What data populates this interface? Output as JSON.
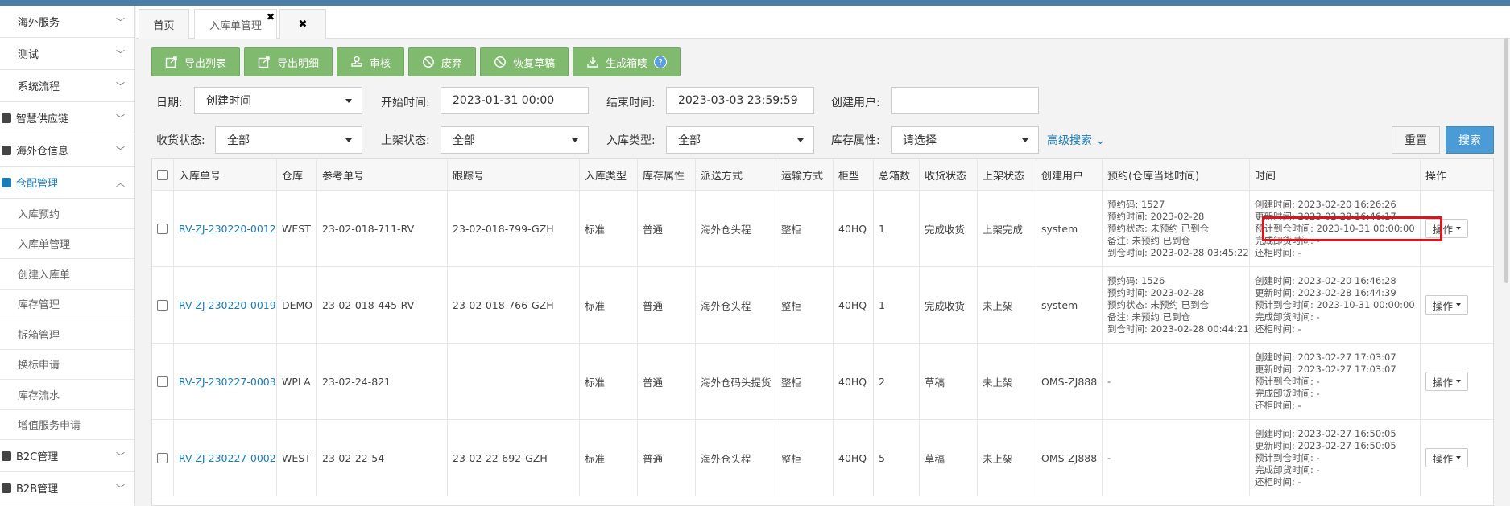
{
  "sidebar": {
    "groups_top": [
      {
        "label": "海外服务"
      },
      {
        "label": "测试"
      },
      {
        "label": "系统流程"
      },
      {
        "label": "智慧供应链"
      },
      {
        "label": "海外仓信息"
      },
      {
        "label": "仓配管理"
      }
    ],
    "sub_items": [
      {
        "label": "入库预约"
      },
      {
        "label": "入库单管理"
      },
      {
        "label": "创建入库单"
      },
      {
        "label": "库存管理"
      },
      {
        "label": "拆箱管理"
      },
      {
        "label": "换标申请"
      },
      {
        "label": "库存流水"
      },
      {
        "label": "增值服务申请"
      }
    ],
    "groups_bottom": [
      {
        "label": "B2C管理"
      },
      {
        "label": "B2B管理"
      }
    ]
  },
  "tabs": [
    {
      "label": "首页"
    },
    {
      "label": "入库单管理"
    }
  ],
  "toolbar": {
    "buttons": [
      {
        "label": "导出列表",
        "icon": "export-icon"
      },
      {
        "label": "导出明细",
        "icon": "export-icon"
      },
      {
        "label": "审核",
        "icon": "stamp-icon"
      },
      {
        "label": "废弃",
        "icon": "ban-icon"
      },
      {
        "label": "恢复草稿",
        "icon": "ban-icon"
      },
      {
        "label": "生成箱唛",
        "icon": "download-icon"
      }
    ],
    "help": "?"
  },
  "filters": {
    "date_label": "日期:",
    "date_value": "创建时间",
    "start_label": "开始时间:",
    "start_value": "2023-01-31 00:00",
    "end_label": "结束时间:",
    "end_value": "2023-03-03 23:59:59",
    "user_label": "创建用户:",
    "user_value": "",
    "receive_label": "收货状态:",
    "receive_value": "全部",
    "shelf_label": "上架状态:",
    "shelf_value": "全部",
    "type_label": "入库类型:",
    "type_value": "全部",
    "attr_label": "库存属性:",
    "attr_value": "请选择",
    "advanced": "高级搜索 ⌄",
    "reset": "重置",
    "search": "搜索"
  },
  "table": {
    "headers": [
      "入库单号",
      "仓库",
      "参考单号",
      "跟踪号",
      "入库类型",
      "库存属性",
      "派送方式",
      "运输方式",
      "柜型",
      "总箱数",
      "收货状态",
      "上架状态",
      "创建用户",
      "预约(仓库当地时间)",
      "时间",
      "操作"
    ],
    "rows": [
      {
        "order": "RV-ZJ-230220-0012",
        "warehouse": "WEST",
        "ref": "23-02-018-711-RV",
        "track": "23-02-018-799-GZH",
        "type": "标准",
        "attr": "普通",
        "delivery": "海外仓头程",
        "transport": "整柜",
        "container": "40HQ",
        "boxes": "1",
        "receive": "完成收货",
        "shelf": "上架完成",
        "user": "system",
        "booking": [
          "预约码: 1527",
          "预约时间: 2023-02-28",
          "预约状态: 未预约 已到仓",
          "备注: 未预约 已到仓",
          "到仓时间: 2023-02-28 03:45:22"
        ],
        "time": [
          "创建时间: 2023-02-20 16:26:26",
          "更新时间: 2023-02-28 16:46:17",
          "预计到仓时间: 2023-10-31 00:00:00",
          "完成卸货时间: -",
          "还柜时间: -"
        ],
        "op": "操作"
      },
      {
        "order": "RV-ZJ-230220-0019",
        "warehouse": "DEMO",
        "ref": "23-02-018-445-RV",
        "track": "23-02-018-766-GZH",
        "type": "标准",
        "attr": "普通",
        "delivery": "海外仓头程",
        "transport": "整柜",
        "container": "40HQ",
        "boxes": "1",
        "receive": "完成收货",
        "shelf": "未上架",
        "user": "system",
        "booking": [
          "预约码: 1526",
          "预约时间: 2023-02-28",
          "预约状态: 未预约 已到仓",
          "备注: 未预约 已到仓",
          "到仓时间: 2023-02-28 00:44:21"
        ],
        "time": [
          "创建时间: 2023-02-20 16:46:28",
          "更新时间: 2023-02-28 16:44:39",
          "预计到仓时间: 2023-10-31 00:00:00",
          "完成卸货时间: -",
          "还柜时间: -"
        ],
        "op": "操作"
      },
      {
        "order": "RV-ZJ-230227-0003",
        "warehouse": "WPLA",
        "ref": "23-02-24-821",
        "track": "",
        "type": "标准",
        "attr": "普通",
        "delivery": "海外仓码头提货",
        "transport": "整柜",
        "container": "40HQ",
        "boxes": "2",
        "receive": "草稿",
        "shelf": "未上架",
        "user": "OMS-ZJ888",
        "booking": [
          "-"
        ],
        "time": [
          "创建时间: 2023-02-27 17:03:07",
          "更新时间: 2023-02-27 17:03:07",
          "预计到仓时间: -",
          "完成卸货时间: -",
          "还柜时间: -"
        ],
        "op": "操作"
      },
      {
        "order": "RV-ZJ-230227-0002",
        "warehouse": "WEST",
        "ref": "23-02-22-54",
        "track": "23-02-22-692-GZH",
        "type": "标准",
        "attr": "普通",
        "delivery": "海外仓头程",
        "transport": "整柜",
        "container": "40HQ",
        "boxes": "5",
        "receive": "草稿",
        "shelf": "未上架",
        "user": "OMS-ZJ888",
        "booking": [
          "-"
        ],
        "time": [
          "创建时间: 2023-02-27 16:50:05",
          "更新时间: 2023-02-27 16:50:05",
          "预计到仓时间: -",
          "完成卸货时间: -",
          "还柜时间: -"
        ],
        "op": "操作"
      }
    ]
  },
  "colors": {
    "accent": "#1a7bb9",
    "toolbar_green": "#7fba6f",
    "search_blue": "#4b9bd6",
    "highlight_red": "#e0131a"
  }
}
